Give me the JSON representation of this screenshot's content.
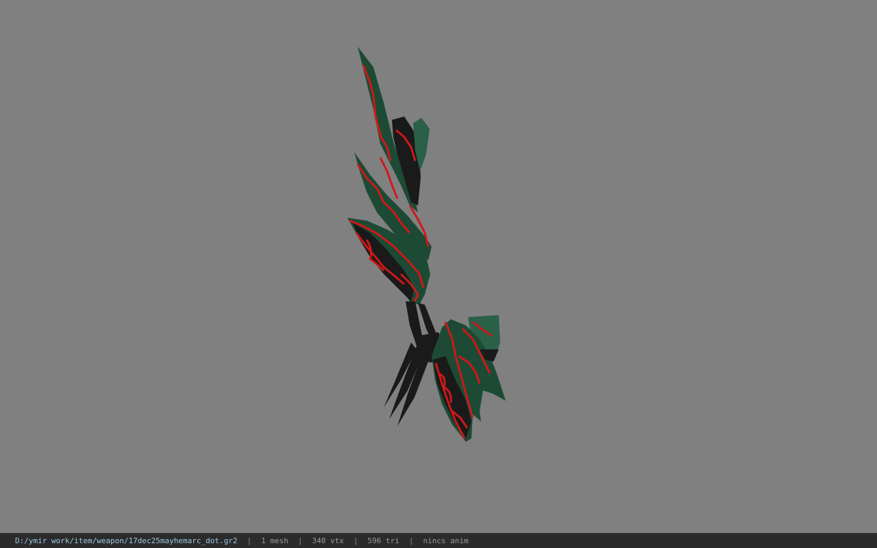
{
  "viewport": {
    "background": "#808080",
    "model": {
      "palette": {
        "green": "#1d4a34",
        "green_light": "#2a6048",
        "black": "#1a1a1a",
        "red": "#d01818"
      }
    }
  },
  "status_bar": {
    "file_path": "D:/ymir work/item/weapon/17dec25mayhemarc_dot.gr2",
    "separator": "|",
    "mesh_count": "1 mesh",
    "vertex_count": "340 vtx",
    "triangle_count": "596 tri",
    "anim_status": "nincs anim"
  }
}
